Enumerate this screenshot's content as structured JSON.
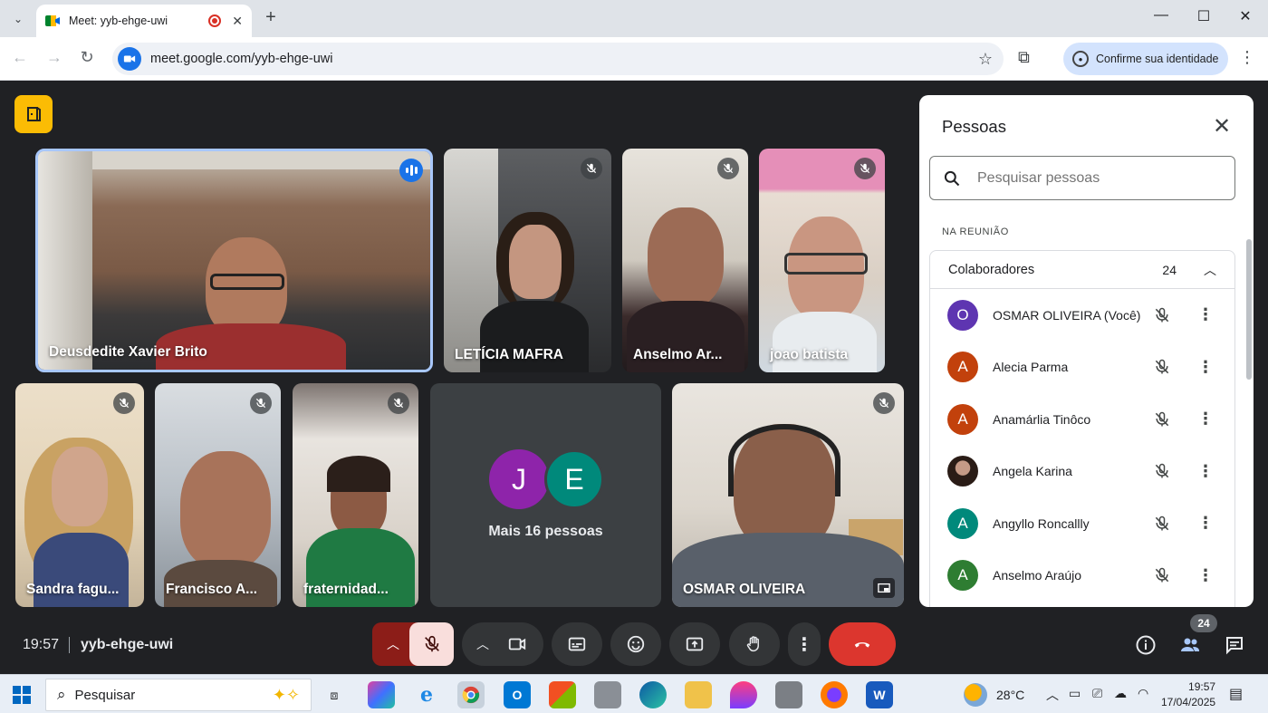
{
  "browser": {
    "tab_title": "Meet: yyb-ehge-uwi",
    "tab_close": "✕",
    "new_tab": "+",
    "url": "meet.google.com/yyb-ehge-uwi",
    "identity_button": "Confirme sua identidade",
    "window_controls": [
      "—",
      "☐",
      "✕"
    ]
  },
  "tiles": [
    {
      "name": "Deusdedite Xavier Brito",
      "speaking": true
    },
    {
      "name": "LETÍCIA MAFRA",
      "muted": true
    },
    {
      "name": "Anselmo Ar...",
      "muted": true
    },
    {
      "name": "joao batista",
      "muted": true
    },
    {
      "name": "Sandra fagu...",
      "muted": true
    },
    {
      "name": "Francisco A...",
      "muted": true
    },
    {
      "name": "fraternidad...",
      "muted": true
    },
    {
      "name": "OSMAR OLIVEIRA",
      "muted": true
    }
  ],
  "more_tile": {
    "avatars": [
      "J",
      "E"
    ],
    "label": "Mais 16 pessoas"
  },
  "people_panel": {
    "title": "Pessoas",
    "search_placeholder": "Pesquisar pessoas",
    "section_label": "NA REUNIÃO",
    "group_title": "Colaboradores",
    "group_count": "24",
    "participants": [
      {
        "initial": "O",
        "name": "OSMAR OLIVEIRA (Você)",
        "color": "#5e35b1"
      },
      {
        "initial": "A",
        "name": "Alecia Parma",
        "color": "#c2410c"
      },
      {
        "initial": "A",
        "name": "Anamárlia Tinôco",
        "color": "#c2410c"
      },
      {
        "initial": "",
        "name": "Angela Karina",
        "color": "#3b2a22"
      },
      {
        "initial": "A",
        "name": "Angyllo Roncallly",
        "color": "#00897b"
      },
      {
        "initial": "A",
        "name": "Anselmo Araújo",
        "color": "#2e7d32"
      }
    ]
  },
  "meeting_bar": {
    "time": "19:57",
    "code": "yyb-ehge-uwi",
    "participant_badge": "24"
  },
  "taskbar": {
    "search_placeholder": "Pesquisar",
    "weather": "28°C",
    "time": "19:57",
    "date": "17/04/2025"
  }
}
